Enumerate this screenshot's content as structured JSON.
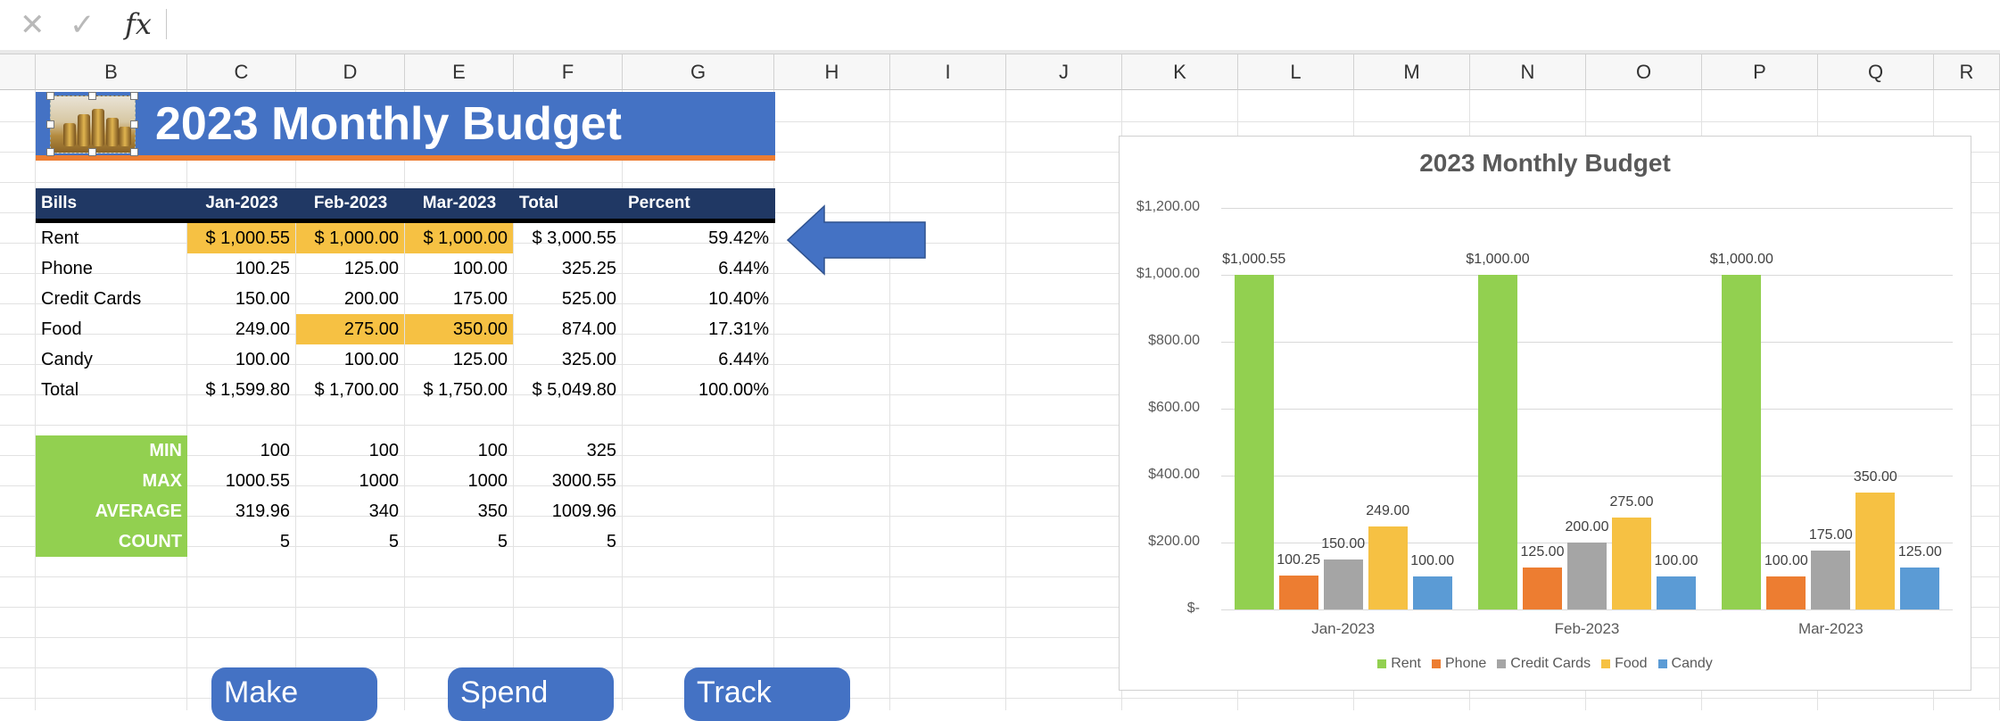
{
  "columns": [
    "B",
    "C",
    "D",
    "E",
    "F",
    "G",
    "H",
    "I",
    "J",
    "K",
    "L",
    "M",
    "N",
    "O",
    "P",
    "Q",
    "R"
  ],
  "colors": {
    "header_bg": "#203864",
    "banner_bg": "#4472c4",
    "banner_underline": "#ed7d31",
    "highlight": "#f6c143",
    "stat_bg": "#92d050",
    "arrow": "#4472c4"
  },
  "banner": {
    "title": "2023 Monthly Budget"
  },
  "table": {
    "headers": [
      "Bills",
      "Jan-2023",
      "Feb-2023",
      "Mar-2023",
      "Total",
      "Percent"
    ],
    "rows": [
      {
        "label": "Rent",
        "values": [
          "$ 1,000.55",
          "$ 1,000.00",
          "$ 1,000.00",
          "$ 3,000.55",
          "59.42%"
        ],
        "highlight": [
          true,
          true,
          true,
          false,
          false
        ]
      },
      {
        "label": "Phone",
        "values": [
          "100.25",
          "125.00",
          "100.00",
          "325.25",
          "6.44%"
        ],
        "highlight": [
          false,
          false,
          false,
          false,
          false
        ]
      },
      {
        "label": "Credit Cards",
        "values": [
          "150.00",
          "200.00",
          "175.00",
          "525.00",
          "10.40%"
        ],
        "highlight": [
          false,
          false,
          false,
          false,
          false
        ]
      },
      {
        "label": "Food",
        "values": [
          "249.00",
          "275.00",
          "350.00",
          "874.00",
          "17.31%"
        ],
        "highlight": [
          false,
          true,
          true,
          false,
          false
        ]
      },
      {
        "label": "Candy",
        "values": [
          "100.00",
          "100.00",
          "125.00",
          "325.00",
          "6.44%"
        ],
        "highlight": [
          false,
          false,
          false,
          false,
          false
        ]
      },
      {
        "label": "Total",
        "values": [
          "$ 1,599.80",
          "$ 1,700.00",
          "$ 1,750.00",
          "$ 5,049.80",
          "100.00%"
        ],
        "highlight": [
          false,
          false,
          false,
          false,
          false
        ]
      }
    ]
  },
  "stats": [
    {
      "label": "MIN",
      "values": [
        "100",
        "100",
        "100",
        "325"
      ]
    },
    {
      "label": "MAX",
      "values": [
        "1000.55",
        "1000",
        "1000",
        "3000.55"
      ]
    },
    {
      "label": "AVERAGE",
      "values": [
        "319.96",
        "340",
        "350",
        "1009.96"
      ]
    },
    {
      "label": "COUNT",
      "values": [
        "5",
        "5",
        "5",
        "5"
      ]
    }
  ],
  "buttons": [
    "Make",
    "Spend",
    "Track"
  ],
  "icons": {
    "cancel": "close-icon",
    "confirm": "check-icon",
    "function": "fx-icon"
  },
  "formula_bar": {
    "fx_label": "fx"
  },
  "chart_data": {
    "type": "bar",
    "title": "2023 Monthly Budget",
    "categories": [
      "Jan-2023",
      "Feb-2023",
      "Mar-2023"
    ],
    "series": [
      {
        "name": "Rent",
        "color": "#92d050",
        "values": [
          1000.55,
          1000.0,
          1000.0
        ],
        "labels": [
          "$1,000.55",
          "$1,000.00",
          "$1,000.00"
        ]
      },
      {
        "name": "Phone",
        "color": "#ed7d31",
        "values": [
          100.25,
          125.0,
          100.0
        ],
        "labels": [
          "100.25",
          "125.00",
          "100.00"
        ]
      },
      {
        "name": "Credit Cards",
        "color": "#a5a5a5",
        "values": [
          150.0,
          200.0,
          175.0
        ],
        "labels": [
          "150.00",
          "200.00",
          "175.00"
        ]
      },
      {
        "name": "Food",
        "color": "#f6c143",
        "values": [
          249.0,
          275.0,
          350.0
        ],
        "labels": [
          "249.00",
          "275.00",
          "350.00"
        ]
      },
      {
        "name": "Candy",
        "color": "#5b9bd5",
        "values": [
          100.0,
          100.0,
          125.0
        ],
        "labels": [
          "100.00",
          "100.00",
          "125.00"
        ]
      }
    ],
    "ylim": [
      0,
      1200
    ],
    "yticks": [
      0,
      200,
      400,
      600,
      800,
      1000,
      1200
    ],
    "ytick_labels": [
      "$-",
      "$200.00",
      "$400.00",
      "$600.00",
      "$800.00",
      "$1,000.00",
      "$1,200.00"
    ],
    "grid": true,
    "legend": "bottom"
  }
}
